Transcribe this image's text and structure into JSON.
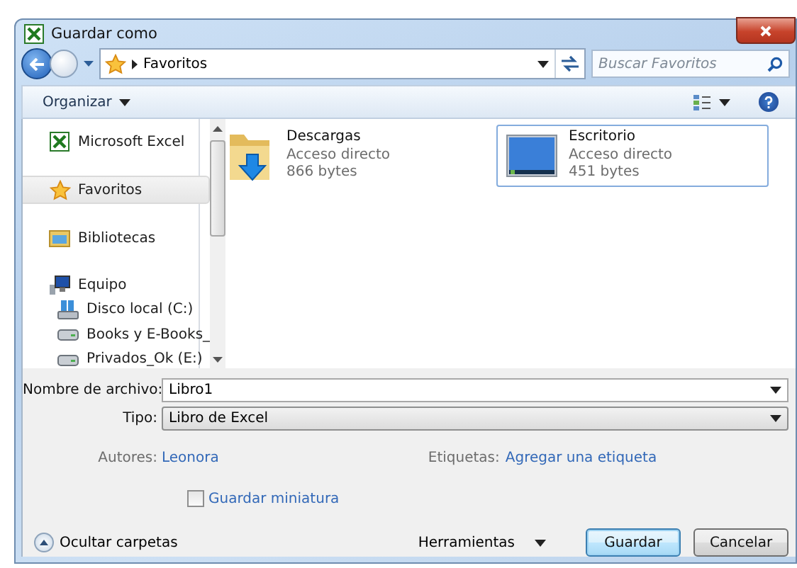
{
  "window": {
    "title": "Guardar como"
  },
  "address": {
    "path": "Favoritos"
  },
  "search": {
    "placeholder": "Buscar Favoritos"
  },
  "toolbar": {
    "organize": "Organizar"
  },
  "sidebar": {
    "items": [
      {
        "label": "Microsoft Excel",
        "kind": "excel",
        "selected": false
      },
      {
        "label": "Favoritos",
        "kind": "favorites",
        "selected": true
      },
      {
        "label": "Bibliotecas",
        "kind": "libraries",
        "selected": false
      },
      {
        "label": "Equipo",
        "kind": "computer",
        "selected": false,
        "children": [
          {
            "label": "Disco local (C:)",
            "kind": "system-drive",
            "selected": false
          },
          {
            "label": "Books y E-Books_",
            "kind": "drive",
            "selected": false
          },
          {
            "label": "Privados_Ok (E:)",
            "kind": "drive",
            "selected": false
          }
        ]
      }
    ]
  },
  "files": [
    {
      "name": "Descargas",
      "type": "Acceso directo",
      "size": "866 bytes",
      "kind": "folder",
      "selected": false
    },
    {
      "name": "Escritorio",
      "type": "Acceso directo",
      "size": "451 bytes",
      "kind": "desktop",
      "selected": true
    }
  ],
  "form": {
    "filename_label": "Nombre de archivo:",
    "filename": "Libro1",
    "type_label": "Tipo:",
    "type": "Libro de Excel",
    "authors_label": "Autores:",
    "authors": "Leonora",
    "tags_label": "Etiquetas:",
    "tags": "Agregar una etiqueta"
  },
  "thumbnail": {
    "label": "Guardar miniatura",
    "checked": false
  },
  "footer": {
    "hide_folders": "Ocultar carpetas",
    "tools": "Herramientas",
    "buttons": [
      {
        "label": "Guardar",
        "default": true
      },
      {
        "label": "Cancelar",
        "default": false
      }
    ]
  }
}
